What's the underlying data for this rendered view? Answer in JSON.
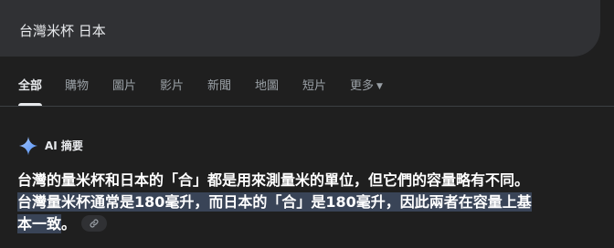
{
  "search": {
    "query": "台灣米杯 日本"
  },
  "tabs": [
    {
      "label": "全部",
      "active": true
    },
    {
      "label": "購物"
    },
    {
      "label": "圖片"
    },
    {
      "label": "影片"
    },
    {
      "label": "新聞"
    },
    {
      "label": "地圖"
    },
    {
      "label": "短片"
    },
    {
      "label": "更多"
    }
  ],
  "ai_overview": {
    "title": "AI 摘要",
    "icon": "sparkle-icon",
    "accent_color": "#8ab4f8",
    "sentence_1": "台灣的量米杯和日本的「合」都是用來測量米的單位，但它們的容量略有不同。",
    "sentence_2_line_1": "台灣量米杯通常是180毫升，而日本的「合」是180毫升，因此兩者在容量上基",
    "sentence_2_line_2": "本一致",
    "sentence_2_end": "。",
    "highlight_color": "#394457",
    "link_icon": "link-icon"
  }
}
